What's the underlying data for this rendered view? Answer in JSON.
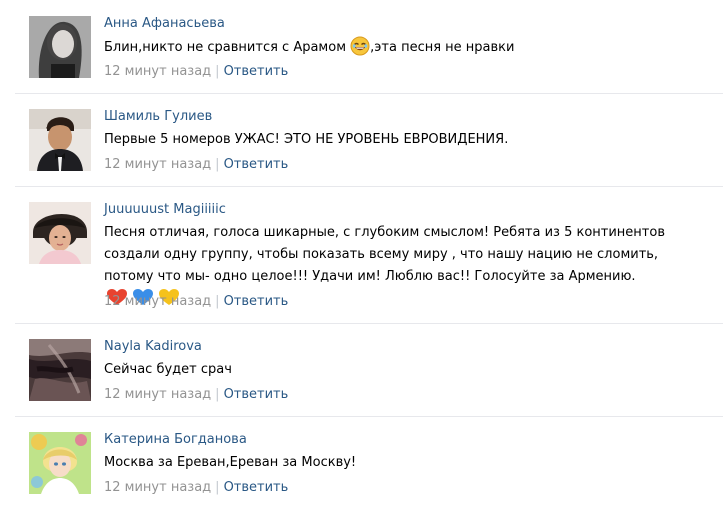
{
  "comments": [
    {
      "author": "Анна Афанасьева",
      "text_before": "Блин,никто не сравнится с Арамом ",
      "emoji": "laughing-face-icon",
      "text_after": ",эта песня не нравки",
      "time": "12 минут назад",
      "reply": "Ответить"
    },
    {
      "author": "Шамиль Гулиев",
      "text": "Первые 5 номеров УЖАС! ЭТО НЕ УРОВЕНЬ ЕВРОВИДЕНИЯ.",
      "time": "12 минут назад",
      "reply": "Ответить"
    },
    {
      "author": "Juuuuuust Magiiiiic",
      "text": "Песня отличая, голоса шикарные, с глубоким смыслом! Ребята из 5 континентов создали одну группу, чтобы показать всему миру , что нашу нацию не сломить, потому что мы- одно целое!!! Удачи им! Люблю вас!! Голосуйте за Армению.",
      "hearts": [
        "#e8432f",
        "#3a8ee8",
        "#f5c21b"
      ],
      "time": "12 минут назад",
      "reply": "Ответить"
    },
    {
      "author": "Nayla Kadirova",
      "text": "Сейчас будет срач",
      "time": "12 минут назад",
      "reply": "Ответить"
    },
    {
      "author": "Катерина Богданова",
      "text": "Москва за Ереван,Ереван за Москву!",
      "time": "12 минут назад",
      "reply": "Ответить"
    }
  ],
  "separator": "|",
  "colors": {
    "link": "#2a5885",
    "meta": "#939393",
    "divider": "#e7e8ec"
  }
}
